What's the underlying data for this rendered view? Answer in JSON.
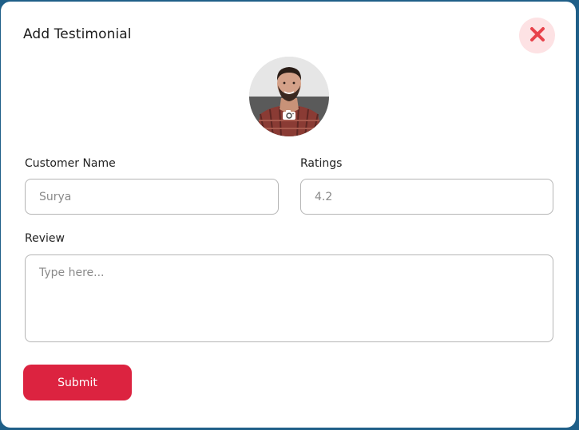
{
  "modal": {
    "title": "Add Testimonial",
    "close_icon": "close-x-icon",
    "avatar": {
      "alt": "customer photo",
      "camera_icon": "camera-icon"
    }
  },
  "form": {
    "customer_name": {
      "label": "Customer Name",
      "placeholder": "Surya",
      "value": ""
    },
    "ratings": {
      "label": "Ratings",
      "placeholder": "4.2",
      "value": ""
    },
    "review": {
      "label": "Review",
      "placeholder": "Type here...",
      "value": ""
    },
    "submit_label": "Submit"
  },
  "colors": {
    "accent": "#dc2340",
    "close_bg": "#fde2e4",
    "close_icon": "#e8424b",
    "border": "#b5b5b5"
  }
}
